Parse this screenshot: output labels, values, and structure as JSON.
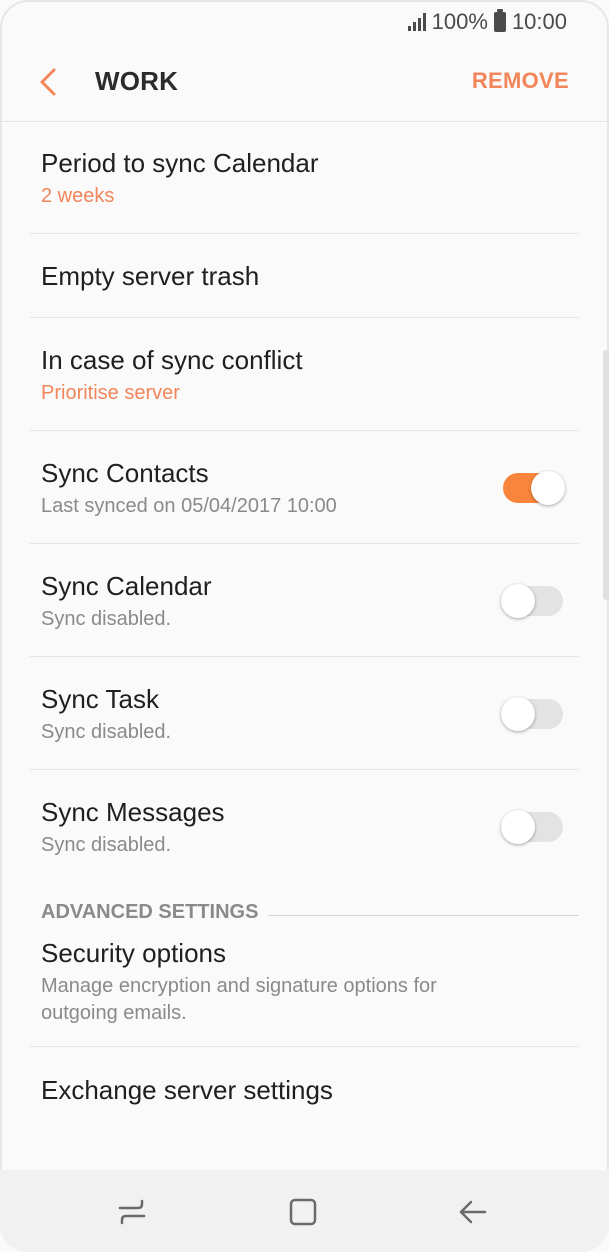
{
  "status_bar": {
    "battery_percent": "100%",
    "time": "10:00",
    "icons": [
      "signal-icon",
      "battery-icon"
    ]
  },
  "app_bar": {
    "title": "WORK",
    "action": "REMOVE",
    "back_icon": "back-chevron-icon"
  },
  "colors": {
    "accent": "#f2865a",
    "toggle_on": "#f9853c",
    "toggle_off": "#e3e3e3"
  },
  "settings": {
    "period_sync_calendar": {
      "label": "Period to sync Calendar",
      "value": "2 weeks"
    },
    "empty_server_trash": {
      "label": "Empty server trash"
    },
    "sync_conflict": {
      "label": "In case of sync conflict",
      "value": "Prioritise server"
    },
    "sync_contacts": {
      "label": "Sync Contacts",
      "status": "Last synced on 05/04/2017  10:00",
      "enabled": true
    },
    "sync_calendar": {
      "label": "Sync Calendar",
      "status": "Sync disabled.",
      "enabled": false
    },
    "sync_task": {
      "label": "Sync Task",
      "status": "Sync disabled.",
      "enabled": false
    },
    "sync_messages": {
      "label": "Sync Messages",
      "status": "Sync disabled.",
      "enabled": false
    }
  },
  "advanced": {
    "header": "ADVANCED SETTINGS",
    "security_options": {
      "label": "Security options",
      "description": "Manage encryption and signature options for outgoing emails."
    },
    "exchange_server_settings": {
      "label": "Exchange server settings"
    }
  },
  "nav_bar": {
    "icons": [
      "recent-apps-icon",
      "home-icon",
      "back-arrow-icon"
    ]
  }
}
